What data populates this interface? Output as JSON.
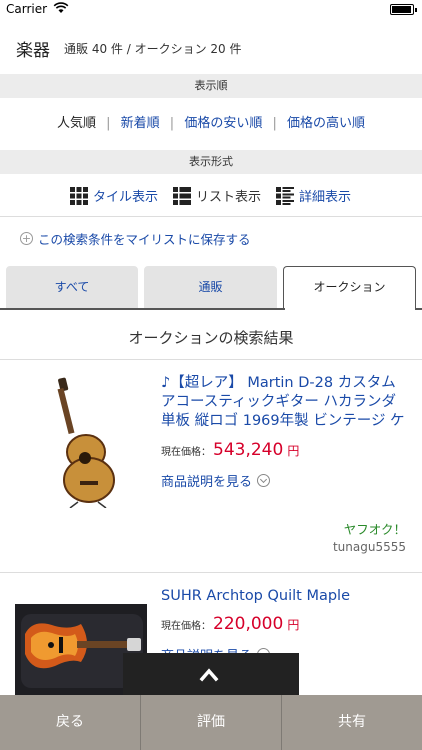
{
  "status_bar": {
    "carrier": "Carrier",
    "time": ""
  },
  "header": {
    "category": "楽器",
    "counts": "通販 40 件 / オークション 20 件"
  },
  "sort": {
    "section_label": "表示順",
    "options": [
      "人気順",
      "新着順",
      "価格の安い順",
      "価格の高い順"
    ],
    "separator": "|"
  },
  "view": {
    "section_label": "表示形式",
    "options": [
      {
        "label": "タイル表示",
        "icon": "tile-grid-icon"
      },
      {
        "label": "リスト表示",
        "icon": "list-icon"
      },
      {
        "label": "詳細表示",
        "icon": "detail-list-icon"
      }
    ]
  },
  "save_search": {
    "label": "この検索条件をマイリストに保存する",
    "icon": "plus-circle-icon"
  },
  "tabs": [
    "すべて",
    "通販",
    "オークション"
  ],
  "active_tab": "オークション",
  "results_title": "オークションの検索結果",
  "items": [
    {
      "title": "♪【超レア】 Martin D-28 カスタム アコースティックギター ハカランダ単板 縦ロゴ 1969年製 ビンテージ ケ",
      "price_label": "現在価格：",
      "price": "543,240",
      "currency": "円",
      "description_link": "商品説明を見る",
      "site": "ヤフオク！",
      "seller": "tunagu5555"
    },
    {
      "title": "SUHR Archtop Quilt Maple",
      "price_label": "現在価格：",
      "price": "220,000",
      "currency": "円",
      "description_link": "商品説明を見る"
    }
  ],
  "toolbar": {
    "back": "戻る",
    "rate": "評価",
    "share": "共有"
  },
  "colors": {
    "link": "#1a4aa8",
    "price": "#d6002a",
    "site": "#2a8a2a",
    "toolbar": "#a09a92"
  }
}
